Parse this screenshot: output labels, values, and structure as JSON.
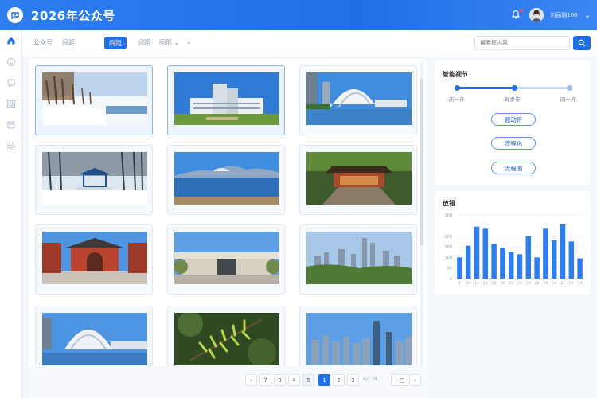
{
  "app": {
    "title": "2026年公众号",
    "user_name": "刘丽娟100"
  },
  "filterbar": {
    "crumbs": [
      "公众号",
      "间距"
    ],
    "active_tab": "间距",
    "dropdowns": [
      "题",
      "间距",
      "图形"
    ],
    "search_placeholder": "搜索框内容"
  },
  "sidebar": {
    "items": [
      "home-icon",
      "smile-icon",
      "message-icon",
      "grid-icon",
      "save-icon",
      "settings-icon"
    ]
  },
  "gallery": {
    "images": [
      {
        "name": "snow-park-thumbnail",
        "selected": true
      },
      {
        "name": "modern-building-thumbnail",
        "selected": true
      },
      {
        "name": "waterfront-arch-thumbnail",
        "selected": false
      },
      {
        "name": "snow-pavilion-thumbnail",
        "selected": false
      },
      {
        "name": "lake-mountain-thumbnail",
        "selected": false
      },
      {
        "name": "garden-pavilion-thumbnail",
        "selected": false
      },
      {
        "name": "red-gate-thumbnail",
        "selected": false
      },
      {
        "name": "campus-gate-thumbnail",
        "selected": false
      },
      {
        "name": "city-skyline-thumbnail",
        "selected": false
      },
      {
        "name": "arch-bridge-thumbnail",
        "selected": false
      },
      {
        "name": "pine-branch-thumbnail",
        "selected": false
      },
      {
        "name": "downtown-towers-thumbnail",
        "selected": false
      }
    ]
  },
  "pagination": {
    "pages": [
      "7",
      "8",
      "4",
      "5",
      "1",
      "2",
      "3"
    ],
    "current": "1",
    "trail_text": "4/- /4",
    "jump_label": "~三"
  },
  "steps_panel": {
    "title": "智能视节",
    "steps": [
      "历一齐",
      "异步带",
      "同一齐"
    ],
    "buttons": [
      "题动符",
      "流程化",
      "流程图"
    ]
  },
  "chart_panel": {
    "title": "放错"
  },
  "chart_data": {
    "type": "bar",
    "title": "放错",
    "categories": [
      "4",
      "28",
      "14",
      "23",
      "15",
      "20",
      "21",
      "23",
      "25",
      "28",
      "19",
      "18",
      "21",
      "23",
      "19"
    ],
    "values": [
      100,
      155,
      245,
      235,
      165,
      145,
      125,
      115,
      200,
      100,
      235,
      180,
      255,
      175,
      95
    ],
    "ylim": [
      0,
      300
    ],
    "yticks": [
      "0",
      "50",
      "100",
      "150",
      "200",
      "300"
    ],
    "bar_color": "#2f7ef0",
    "grid": true
  }
}
